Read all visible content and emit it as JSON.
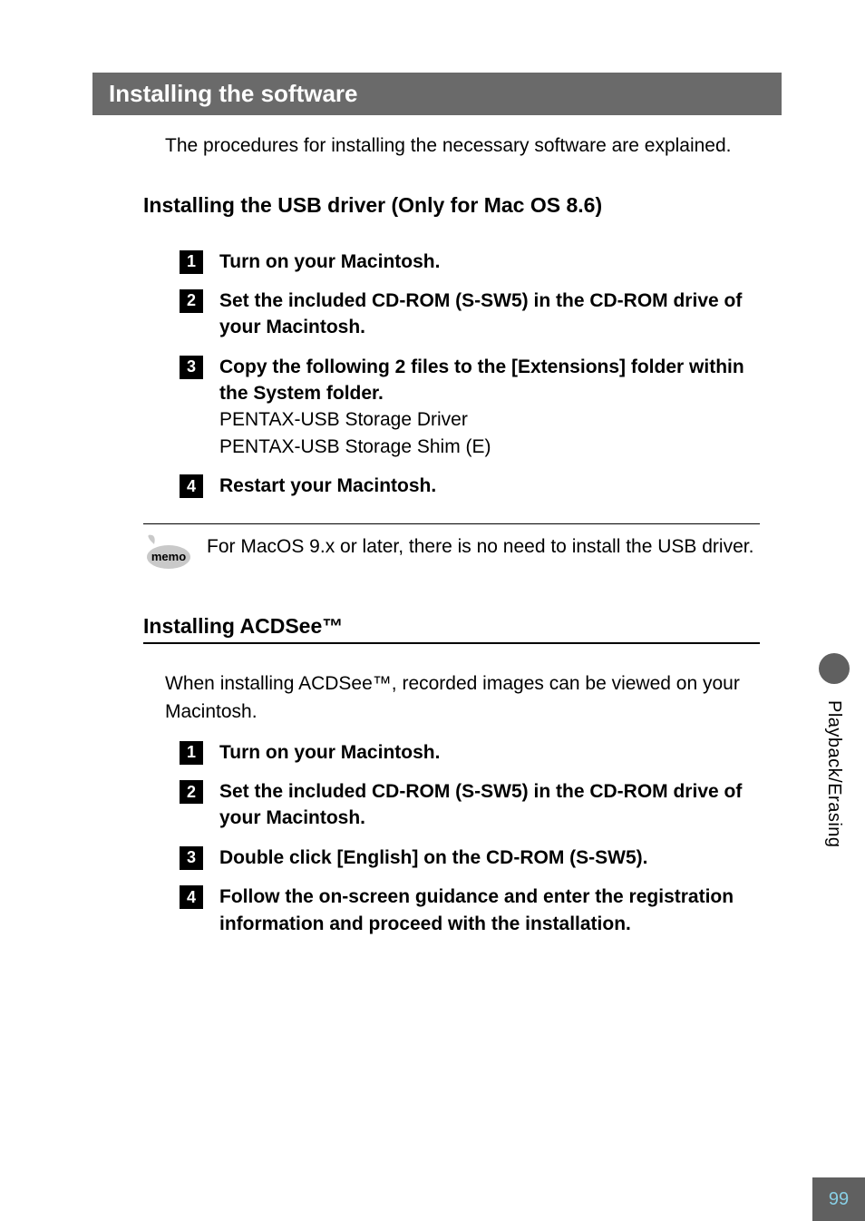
{
  "section_title": "Installing the software",
  "intro_text": "The procedures for installing the necessary software are explained.",
  "subsection1_title": "Installing the USB driver (Only for Mac OS 8.6)",
  "steps1": [
    {
      "n": "1",
      "bold": "Turn on your Macintosh.",
      "desc": ""
    },
    {
      "n": "2",
      "bold": "Set the included CD-ROM (S-SW5) in the CD-ROM drive of your Macintosh.",
      "desc": ""
    },
    {
      "n": "3",
      "bold": "Copy the following 2 files to the [Extensions] folder within the System folder.",
      "desc": "PENTAX-USB Storage Driver\nPENTAX-USB Storage Shim (E)"
    },
    {
      "n": "4",
      "bold": "Restart your Macintosh.",
      "desc": ""
    }
  ],
  "memo_label": "memo",
  "memo_text": "For MacOS 9.x or later, there is no need to install the USB driver.",
  "subsection2_title": "Installing ACDSee™",
  "intro2_text": "When installing ACDSee™, recorded images can be viewed on your Macintosh.",
  "steps2": [
    {
      "n": "1",
      "bold": "Turn on your Macintosh.",
      "desc": ""
    },
    {
      "n": "2",
      "bold": "Set the included CD-ROM (S-SW5) in the CD-ROM drive of your Macintosh.",
      "desc": ""
    },
    {
      "n": "3",
      "bold": "Double click [English] on the CD-ROM (S-SW5).",
      "desc": ""
    },
    {
      "n": "4",
      "bold": "Follow the on-screen guidance and enter the registration information and proceed with the installation.",
      "desc": ""
    }
  ],
  "side_tab_label": "Playback/Erasing",
  "page_number": "99"
}
